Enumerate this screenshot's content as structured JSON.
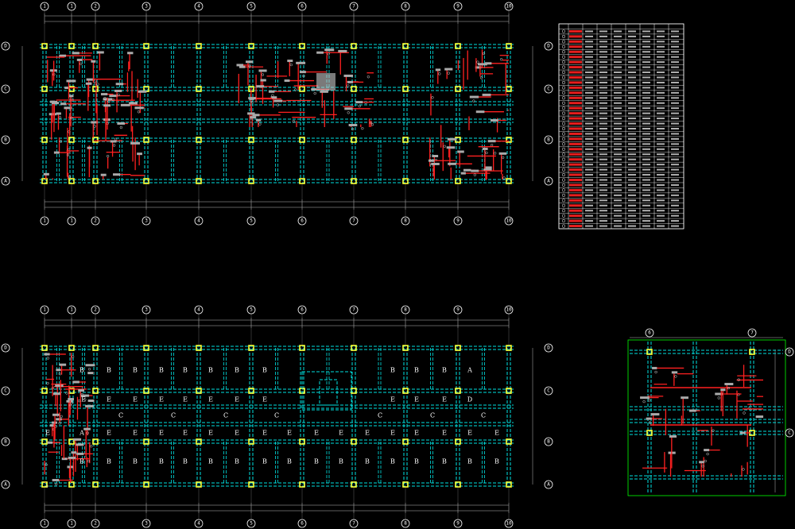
{
  "plans": {
    "top": {
      "col_labels": [
        "1",
        "1",
        "2",
        "3",
        "4",
        "5",
        "6",
        "7",
        "8",
        "9",
        "10"
      ],
      "row_labels": [
        "D",
        "C",
        "B",
        "A"
      ]
    },
    "bottom": {
      "col_labels": [
        "1",
        "1",
        "2",
        "3",
        "4",
        "5",
        "6",
        "7",
        "8",
        "9",
        "10"
      ],
      "row_labels": [
        "D",
        "C",
        "B",
        "A"
      ],
      "slab_rows": [
        [
          "B",
          "B",
          "B",
          "B",
          "B",
          "B",
          "B",
          "B",
          "B",
          "B",
          "A"
        ],
        [
          "E",
          "E",
          "E",
          "E",
          "E",
          "E",
          "E",
          "E",
          "E",
          "E",
          "D"
        ],
        [
          "C",
          "C",
          "C",
          "C",
          "C",
          "C",
          "C"
        ],
        [
          "E",
          "E",
          "E",
          "E",
          "E",
          "E",
          "E",
          "E",
          "E",
          "E",
          "E",
          "E",
          "E",
          "E",
          "E",
          "E",
          "D"
        ],
        [
          "B",
          "B",
          "B",
          "B",
          "B",
          "B",
          "B",
          "B",
          "B",
          "B",
          "B",
          "B",
          "B",
          "B",
          "B",
          "B",
          "A"
        ]
      ],
      "left_labels": [
        "B",
        "E",
        "E",
        "A",
        "B"
      ]
    },
    "detail": {
      "col_labels": [
        "6",
        "7"
      ],
      "row_labels": [
        "D",
        "C"
      ]
    }
  },
  "colors": {
    "background": "#000000",
    "beam": "#00e0e0",
    "column": "#ffff33",
    "rebar": "#ff2020",
    "annotation": "#ffffff",
    "detail_frame": "#00ff00"
  }
}
